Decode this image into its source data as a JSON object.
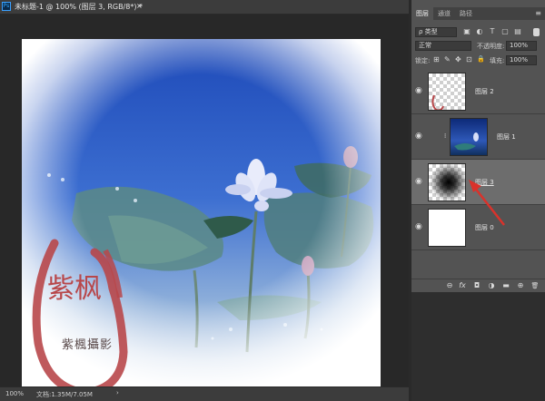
{
  "document": {
    "tab_title": "未标题-1 @ 100% (图层 3, RGB/8*) *",
    "close_symbol": "×",
    "ps_logo": "Ps",
    "seal_chars": "紫枫",
    "seal_caption": "紫楓攝影"
  },
  "status": {
    "zoom": "100%",
    "doc_info": "文档:1.35M/7.05M",
    "arrow": "›"
  },
  "panel": {
    "tabs": [
      "图层",
      "通道",
      "路径"
    ],
    "active_tab": "图层",
    "menu_icon": "≡",
    "kind_filter": "ρ 类型",
    "filter_icons": [
      "image-filter-icon",
      "adjustment-filter-icon",
      "type-filter-icon",
      "shape-filter-icon",
      "smart-object-filter-icon"
    ],
    "filter_glyphs": [
      "▣",
      "◐",
      "T",
      "▢",
      "▤"
    ],
    "blend_mode": "正常",
    "opacity_label": "不透明度:",
    "opacity_value": "100%",
    "lock_label": "锁定:",
    "lock_glyphs": [
      "⊞",
      "✎",
      "✥",
      "⊡",
      "🔒"
    ],
    "fill_label": "填充:",
    "fill_value": "100%",
    "layers": [
      {
        "name": "图层 2",
        "thumb": "transparent-seal",
        "selected": false
      },
      {
        "name": "图层 1",
        "thumb": "lotus-photo",
        "selected": false,
        "linked_mask": true
      },
      {
        "name": "图层 3",
        "thumb": "radial-gradient",
        "selected": true
      },
      {
        "name": "图层 0",
        "thumb": "white",
        "selected": false
      }
    ],
    "footer_icons": [
      "link-layers-icon",
      "fx-icon",
      "add-mask-icon",
      "adjustment-layer-icon",
      "new-group-icon",
      "new-layer-icon",
      "delete-layer-icon"
    ],
    "footer_glyphs": [
      "⊖",
      "fx",
      "◘",
      "◑",
      "▬",
      "⊕",
      "🗑"
    ]
  },
  "colors": {
    "annotation_arrow": "#d9322b",
    "seal_red": "#b8474a"
  }
}
